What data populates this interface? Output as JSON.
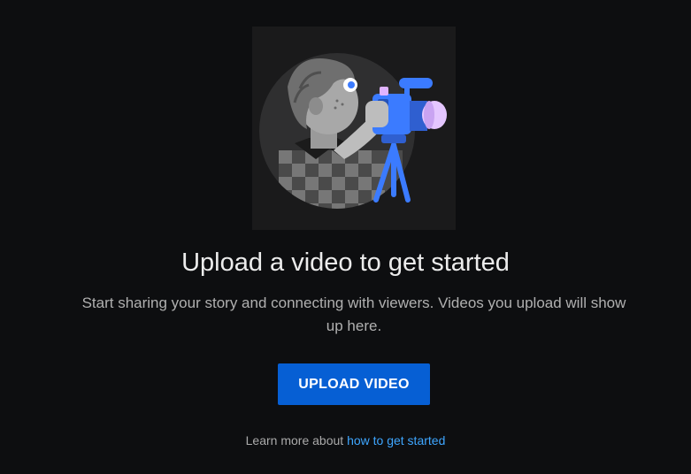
{
  "empty_state": {
    "title": "Upload a video to get started",
    "description": "Start sharing your story and connecting with viewers. Videos you upload will show up here.",
    "upload_button_label": "UPLOAD VIDEO",
    "learn_more_prefix": "Learn more about",
    "learn_more_link": "how to get started",
    "illustration_icon": "camera-operator-illustration"
  },
  "colors": {
    "background": "#0d0e10",
    "button": "#065fd4",
    "link": "#3ea6ff",
    "camera_accent": "#3b7bff"
  }
}
